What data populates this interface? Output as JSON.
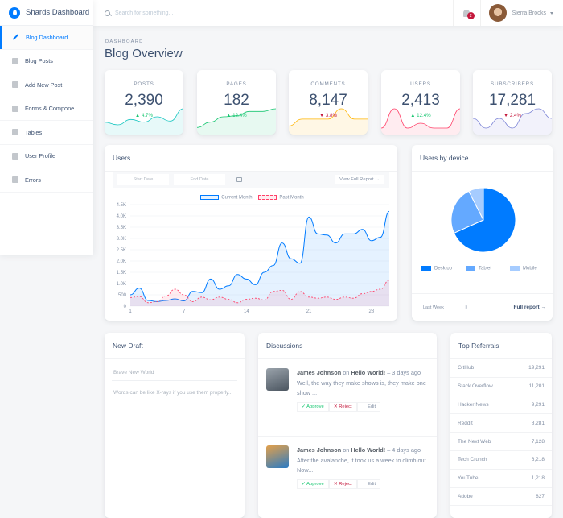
{
  "brand": {
    "name": "Shards Dashboard"
  },
  "sidebar": {
    "items": [
      {
        "label": "Blog Dashboard",
        "icon": "edit-icon",
        "active": true
      },
      {
        "label": "Blog Posts",
        "icon": "list-icon"
      },
      {
        "label": "Add New Post",
        "icon": "file-icon"
      },
      {
        "label": "Forms & Compone...",
        "icon": "grid-icon"
      },
      {
        "label": "Tables",
        "icon": "table-icon"
      },
      {
        "label": "User Profile",
        "icon": "person-icon"
      },
      {
        "label": "Errors",
        "icon": "error-icon"
      }
    ]
  },
  "topbar": {
    "search_placeholder": "Search for something...",
    "notifications": "2",
    "user_name": "Sierra Brooks"
  },
  "page": {
    "subtitle": "DASHBOARD",
    "title": "Blog Overview"
  },
  "stats": [
    {
      "label": "POSTS",
      "value": "2,390",
      "change": "▲ 4.7%",
      "dir": "up",
      "color": "#17c6c0",
      "trend": [
        2,
        1.5,
        2.5,
        2,
        3,
        2.2,
        4.5
      ]
    },
    {
      "label": "PAGES",
      "value": "182",
      "change": "▲ 12.4%",
      "dir": "up",
      "color": "#17c671",
      "trend": [
        1,
        2,
        3,
        3.2,
        4,
        4,
        4.5
      ]
    },
    {
      "label": "COMMENTS",
      "value": "8,147",
      "change": "▼ 3.8%",
      "dir": "down",
      "color": "#ffb400",
      "trend": [
        1,
        2,
        2,
        2,
        3.5,
        2,
        2
      ]
    },
    {
      "label": "USERS",
      "value": "2,413",
      "change": "▲ 12.4%",
      "dir": "up",
      "color": "#ff4169",
      "trend": [
        1,
        5,
        1,
        2,
        1,
        1,
        5
      ]
    },
    {
      "label": "SUBSCRIBERS",
      "value": "17,281",
      "change": "▼ 2.4%",
      "dir": "down",
      "color": "#7b83d6",
      "trend": [
        3,
        1,
        3,
        1,
        4,
        5,
        3
      ]
    }
  ],
  "users_card": {
    "title": "Users",
    "start_placeholder": "Start Date",
    "end_placeholder": "End Date",
    "report_button": "View Full Report →",
    "legend_current": "Current Month",
    "legend_past": "Past Month"
  },
  "chart_data": [
    {
      "type": "line",
      "title": "Users",
      "x": [
        1,
        2,
        3,
        4,
        5,
        6,
        7,
        8,
        9,
        10,
        11,
        12,
        13,
        14,
        15,
        16,
        17,
        18,
        19,
        20,
        21,
        22,
        23,
        24,
        25,
        26,
        27,
        28,
        29
      ],
      "xticks": [
        "1",
        "7",
        "14",
        "21",
        "28"
      ],
      "yticks": [
        "0",
        "500",
        "1.0K",
        "1.5K",
        "2.0K",
        "2.5K",
        "3.0K",
        "3.5K",
        "4.0K",
        "4.5K"
      ],
      "ylim": [
        0,
        4500
      ],
      "series": [
        {
          "name": "Current Month",
          "values": [
            500,
            800,
            250,
            200,
            250,
            320,
            230,
            650,
            600,
            1200,
            750,
            900,
            1400,
            1200,
            950,
            1500,
            1800,
            2800,
            2100,
            1900,
            3950,
            3200,
            3150,
            2800,
            3200,
            3200,
            3400,
            2900,
            3050,
            4200
          ]
        },
        {
          "name": "Past Month",
          "values": [
            380,
            430,
            150,
            200,
            450,
            750,
            500,
            200,
            400,
            280,
            400,
            300,
            150,
            300,
            350,
            270,
            650,
            700,
            300,
            650,
            400,
            350,
            400,
            300,
            400,
            350,
            550,
            650,
            750,
            1150
          ]
        }
      ],
      "legend": "top"
    },
    {
      "type": "pie",
      "title": "Users by device",
      "categories": [
        "Desktop",
        "Tablet",
        "Mobile"
      ],
      "values": [
        68.3,
        24.2,
        7.5
      ],
      "colors": [
        "#007bff",
        "#64a9ff",
        "#a6ccff"
      ]
    }
  ],
  "device_card": {
    "title": "Users by device",
    "range": "Last Week",
    "full_report": "Full report →"
  },
  "draft": {
    "title": "New Draft",
    "title_placeholder": "Brave New World",
    "body_placeholder": "Words can be like X-rays if you use them properly..."
  },
  "discussions": {
    "title": "Discussions",
    "items": [
      {
        "author": "James Johnson",
        "on": "on",
        "post": "Hello World!",
        "time": "– 3 days ago",
        "text": "Well, the way they make shows is, they make one show ...",
        "approve": "✓ Approve",
        "reject": "✕ Reject",
        "edit": "⋮ Edit"
      },
      {
        "author": "James Johnson",
        "on": "on",
        "post": "Hello World!",
        "time": "– 4 days ago",
        "text": "After the avalanche, it took us a week to climb out. Now...",
        "approve": "✓ Approve",
        "reject": "✕ Reject",
        "edit": "⋮ Edit"
      }
    ]
  },
  "referrals": {
    "title": "Top Referrals",
    "rows": [
      {
        "name": "GitHub",
        "value": "19,291"
      },
      {
        "name": "Stack Overflow",
        "value": "11,201"
      },
      {
        "name": "Hacker News",
        "value": "9,291"
      },
      {
        "name": "Reddit",
        "value": "8,281"
      },
      {
        "name": "The Next Web",
        "value": "7,128"
      },
      {
        "name": "Tech Crunch",
        "value": "6,218"
      },
      {
        "name": "YouTube",
        "value": "1,218"
      },
      {
        "name": "Adobe",
        "value": "827"
      }
    ]
  }
}
